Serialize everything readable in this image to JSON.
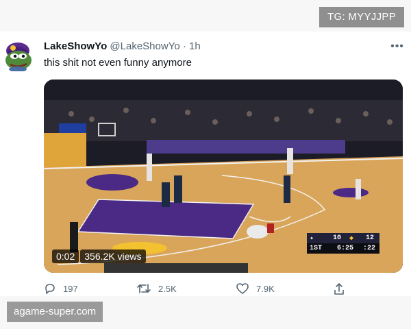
{
  "watermark_top": "TG: MYYJJPP",
  "watermark_bottom": "agame-super.com",
  "tweet": {
    "author_name": "LakeShowYo",
    "handle": "@LakeShowYo",
    "separator": "·",
    "time": "1h",
    "more_label": "•••",
    "text": "this shit not even funny anymore"
  },
  "video": {
    "elapsed": "0:02",
    "views": "356.2K views",
    "scorebug": {
      "away_score": "10",
      "home_score": "12",
      "period": "1ST",
      "clock": "6:25",
      "shot_clock": ":22"
    }
  },
  "actions": {
    "replies": "197",
    "retweets": "2.5K",
    "likes": "7.9K"
  },
  "colors": {
    "text_primary": "#0f1419",
    "text_secondary": "#536471",
    "court_paint": "#4b2a86",
    "court_wood": "#d9a55a"
  },
  "icons": {
    "reply": "reply-icon",
    "retweet": "retweet-icon",
    "like": "like-icon",
    "share": "share-icon",
    "more": "more-icon"
  }
}
